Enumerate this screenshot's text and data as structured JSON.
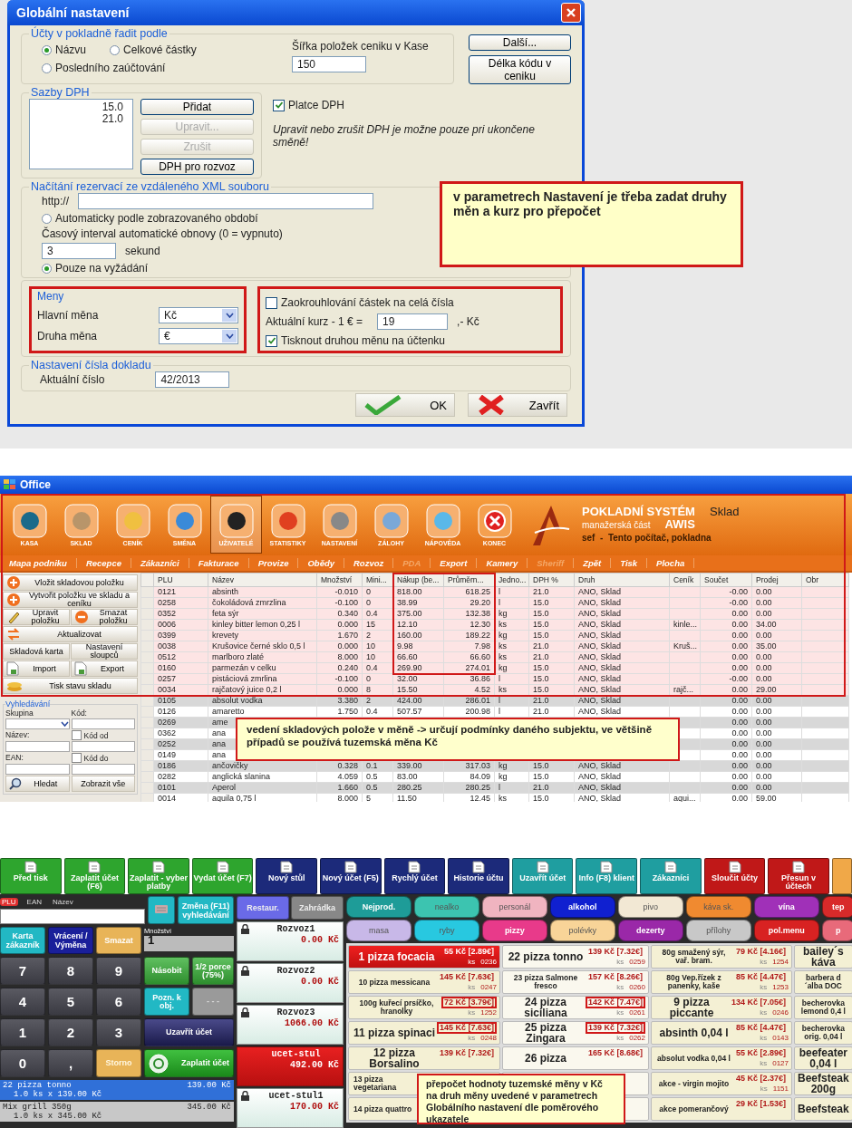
{
  "dialog": {
    "title": "Globální nastavení",
    "sort": {
      "legend": "Účty v pokladně řadit podle",
      "options": [
        {
          "label": "Názvu",
          "selected": true
        },
        {
          "label": "Celkové částky",
          "selected": false
        },
        {
          "label": "Posledního zaúčtování",
          "selected": false
        }
      ],
      "width_label": "Šířka položek ceniku v Kase",
      "width_value": "150"
    },
    "side_buttons": [
      "Další...",
      "Délka kódu v ceniku"
    ],
    "vat": {
      "legend": "Sazby DPH",
      "rates": [
        "15.0",
        "21.0"
      ],
      "buttons": [
        {
          "label": "Přidat",
          "disabled": false
        },
        {
          "label": "Upravit...",
          "disabled": true
        },
        {
          "label": "Zrušit",
          "disabled": true
        },
        {
          "label": "DPH pro rozvoz",
          "disabled": false
        }
      ]
    },
    "vat_payer": {
      "label": "Platce DPH",
      "checked": true
    },
    "note": "Upravit nebo zrušit DPH je možne pouze pri ukončene směně!",
    "reservations": {
      "legend": "Načítání rezervací ze vzdáleného XML souboru",
      "url_label": "http://",
      "auto": {
        "label": "Automaticky podle zobrazovaného období",
        "selected": false
      },
      "interval_label": "Časový interval automatické obnovy (0 = vypnuto)",
      "interval_value": "3",
      "interval_unit": "sekund",
      "on_demand": {
        "label": "Pouze na vyžádání",
        "selected": true
      }
    },
    "currencies": {
      "legend": "Meny",
      "fields": [
        {
          "label": "Hlavní měna",
          "value": "Kč"
        },
        {
          "label": "Druha měna",
          "value": "€"
        }
      ],
      "rounding": {
        "label": "Zaokrouhlování částek na celá čísla",
        "checked": false
      },
      "rate_label": "Aktuální kurz - 1 € =",
      "rate_value": "19",
      "rate_unit": ",- Kč",
      "print_second": {
        "label": "Tisknout druhou měnu na účtenku",
        "checked": true
      }
    },
    "document": {
      "legend": "Nastavení čísla dokladu",
      "label": "Aktuální číslo",
      "value": "42/2013"
    },
    "buttons": [
      {
        "kind": "ok",
        "label": "OK"
      },
      {
        "kind": "close",
        "label": "Zavřít"
      }
    ],
    "callout": "v parametrech Nastavení je třeba zadat druhy měn a kurz pro přepočet"
  },
  "office": {
    "title": "Office",
    "toolbar": [
      {
        "label": "KASA",
        "selected": false
      },
      {
        "label": "SKLAD",
        "selected": false
      },
      {
        "label": "CENÍK",
        "selected": false
      },
      {
        "label": "SMĚNA",
        "selected": false
      },
      {
        "label": "UŽIVATELÉ",
        "selected": true
      },
      {
        "label": "STATISTIKY",
        "selected": false
      },
      {
        "label": "NASTAVENÍ",
        "selected": false
      },
      {
        "label": "ZÁLOHY",
        "selected": false
      },
      {
        "label": "NÁPOVĚDA",
        "selected": false
      },
      {
        "label": "KONEC",
        "selected": false
      }
    ],
    "brand": {
      "title": "POKLADNÍ SYSTÉM",
      "subtitle": "manažerská část",
      "name": "AWIS",
      "module": "Sklad",
      "user": "sef  -  Tento počítač, pokladna"
    },
    "menu": [
      {
        "label": "Mapa podniku",
        "disabled": false
      },
      {
        "label": "Recepce",
        "disabled": false
      },
      {
        "label": "Zákazníci",
        "disabled": false
      },
      {
        "label": "Fakturace",
        "disabled": false
      },
      {
        "label": "Provize",
        "disabled": false
      },
      {
        "label": "Obědy",
        "disabled": false
      },
      {
        "label": "Rozvoz",
        "disabled": false
      },
      {
        "label": "PDA",
        "disabled": true
      },
      {
        "label": "Export",
        "disabled": false
      },
      {
        "label": "Kamery",
        "disabled": false
      },
      {
        "label": "Sheriff",
        "disabled": true
      },
      {
        "label": "Zpět",
        "disabled": false
      },
      {
        "label": "Tisk",
        "disabled": false
      },
      {
        "label": "Plocha",
        "disabled": false
      }
    ],
    "actions": [
      {
        "label": "Vložit skladovou položku",
        "kind": "wide"
      },
      {
        "label": "Vytvořit položku ve skladu a ceníku",
        "kind": "wide"
      },
      {
        "label": "Upravit položku",
        "kind": "half"
      },
      {
        "label": "Smazat položku",
        "kind": "half"
      },
      {
        "label": "Aktualizovat",
        "kind": "wide"
      },
      {
        "label": "Skladová karta",
        "kind": "half"
      },
      {
        "label": "Nastavení sloupců",
        "kind": "half"
      },
      {
        "label": "Import",
        "kind": "half"
      },
      {
        "label": "Export",
        "kind": "half"
      },
      {
        "label": "Tisk stavu skladu",
        "kind": "wide"
      }
    ],
    "search": {
      "legend": "Vyhledávání",
      "group_label": "Skupina",
      "code_label": "Kód:",
      "name_label": "Název:",
      "code_from": {
        "label": "Kód od",
        "checked": false
      },
      "ean_label": "EAN:",
      "code_to": {
        "label": "Kód do",
        "checked": false
      },
      "buttons": [
        "Hledat",
        "Zobrazit vše"
      ]
    },
    "table": {
      "columns": [
        "PLU",
        "Název",
        "Množství",
        "Mini...",
        "Nákup (be...",
        "Průměrn...",
        "Jedno...",
        "DPH %",
        "Druh",
        "Ceník",
        "Součet",
        "Prodej",
        "Obr"
      ],
      "rows": [
        {
          "highlighted": true,
          "cells": [
            "0121",
            "absinth",
            "-0.010",
            "0",
            "818.00",
            "618.25",
            "l",
            "21.0",
            "ANO, Sklad",
            null,
            "-0.00",
            "0.00"
          ]
        },
        {
          "highlighted": true,
          "cells": [
            "0258",
            "čokoládová zmrzlina",
            "-0.100",
            "0",
            "38.99",
            "29.20",
            "l",
            "15.0",
            "ANO, Sklad",
            null,
            "-0.00",
            "0.00"
          ]
        },
        {
          "highlighted": true,
          "cells": [
            "0352",
            "feta sýr",
            "0.340",
            "0.4",
            "375.00",
            "132.38",
            "kg",
            "15.0",
            "ANO, Sklad",
            null,
            "0.00",
            "0.00"
          ]
        },
        {
          "highlighted": true,
          "cells": [
            "0006",
            "kinley bitter lemon 0,25 l",
            "0.000",
            "15",
            "12.10",
            "12.30",
            "ks",
            "15.0",
            "ANO, Sklad",
            "kinle...",
            "0.00",
            "34.00"
          ]
        },
        {
          "highlighted": true,
          "cells": [
            "0399",
            "krevety",
            "1.670",
            "2",
            "160.00",
            "189.22",
            "kg",
            "15.0",
            "ANO, Sklad",
            null,
            "0.00",
            "0.00"
          ]
        },
        {
          "highlighted": true,
          "cells": [
            "0038",
            "Krušovice černé sklo 0,5 l",
            "0.000",
            "10",
            "9.98",
            "7.98",
            "ks",
            "21.0",
            "ANO, Sklad",
            "Kruš...",
            "0.00",
            "35.00"
          ]
        },
        {
          "highlighted": true,
          "cells": [
            "0512",
            "marlboro zlaté",
            "8.000",
            "10",
            "66.60",
            "66.60",
            "ks",
            "21.0",
            "ANO, Sklad",
            null,
            "0.00",
            "0.00"
          ]
        },
        {
          "highlighted": true,
          "cells": [
            "0160",
            "parmezán v celku",
            "0.240",
            "0.4",
            "269.90",
            "274.01",
            "kg",
            "15.0",
            "ANO, Sklad",
            null,
            "0.00",
            "0.00"
          ]
        },
        {
          "highlighted": true,
          "cells": [
            "0257",
            "pistáciová zmrlina",
            "-0.100",
            "0",
            "32.00",
            "36.86",
            "l",
            "15.0",
            "ANO, Sklad",
            null,
            "-0.00",
            "0.00"
          ]
        },
        {
          "highlighted": true,
          "cells": [
            "0034",
            "rajčatový juice 0,2 l",
            "0.000",
            "8",
            "15.50",
            "4.52",
            "ks",
            "15.0",
            "ANO, Sklad",
            "rajč...",
            "0.00",
            "29.00"
          ]
        },
        {
          "highlighted": false,
          "cells": [
            "0105",
            "absolut vodka",
            "3.380",
            "2",
            "424.00",
            "286.01",
            "l",
            "21.0",
            "ANO, Sklad",
            null,
            "0.00",
            "0.00"
          ]
        },
        {
          "highlighted": false,
          "cells": [
            "0126",
            "amaretto",
            "1.750",
            "0.4",
            "507.57",
            "200.98",
            "l",
            "21.0",
            "ANO, Sklad",
            null,
            "0.00",
            "0.00"
          ]
        },
        {
          "highlighted": false,
          "cells": [
            "0269",
            "ame",
            null,
            null,
            null,
            null,
            null,
            null,
            null,
            null,
            "0.00",
            "0.00"
          ]
        },
        {
          "highlighted": false,
          "cells": [
            "0362",
            "ana",
            null,
            null,
            null,
            null,
            null,
            null,
            null,
            null,
            "0.00",
            "0.00"
          ]
        },
        {
          "highlighted": false,
          "cells": [
            "0252",
            "ana",
            null,
            null,
            null,
            null,
            null,
            null,
            null,
            null,
            "0.00",
            "0.00"
          ]
        },
        {
          "highlighted": false,
          "cells": [
            "0149",
            "ana",
            null,
            null,
            null,
            null,
            null,
            null,
            null,
            null,
            "0.00",
            "0.00"
          ]
        },
        {
          "highlighted": false,
          "cells": [
            "0186",
            "ančovičky",
            "0.328",
            "0.1",
            "339.00",
            "317.03",
            "kg",
            "15.0",
            "ANO, Sklad",
            null,
            "0.00",
            "0.00"
          ]
        },
        {
          "highlighted": false,
          "cells": [
            "0282",
            "anglická slanina",
            "4.059",
            "0.5",
            "83.00",
            "84.09",
            "kg",
            "15.0",
            "ANO, Sklad",
            null,
            "0.00",
            "0.00"
          ]
        },
        {
          "highlighted": false,
          "cells": [
            "0101",
            "Aperol",
            "1.660",
            "0.5",
            "280.25",
            "280.25",
            "l",
            "21.0",
            "ANO, Sklad",
            null,
            "0.00",
            "0.00"
          ]
        },
        {
          "highlighted": false,
          "cells": [
            "0014",
            "aquila 0,75 l",
            "8.000",
            "5",
            "11.50",
            "12.45",
            "ks",
            "15.0",
            "ANO, Sklad",
            "aqui...",
            "0.00",
            "59.00"
          ]
        }
      ]
    },
    "callout": "vedení skladových polože v měně -> určují podmínky daného subjektu, ve většině případů se používá tuzemská měna Kč"
  },
  "pos": {
    "top_buttons": [
      {
        "label": "Před tisk",
        "color": "#2ea52e"
      },
      {
        "label": "Zaplatit účet (F6)",
        "color": "#2ea52e"
      },
      {
        "label": "Zaplatit - vyber platby",
        "color": "#2ea52e"
      },
      {
        "label": "Vydat účet (F7)",
        "color": "#2ea52e"
      },
      {
        "label": "Nový stůl",
        "color": "#1c2a7a"
      },
      {
        "label": "Nový účet (F5)",
        "color": "#1c2a7a"
      },
      {
        "label": "Rychlý účet",
        "color": "#1c2a7a"
      },
      {
        "label": "Historie účtu",
        "color": "#1c2a7a"
      },
      {
        "label": "Uzavřít účet",
        "color": "#1f9ea0"
      },
      {
        "label": "Info (F8) klient",
        "color": "#1f9ea0"
      },
      {
        "label": "Zákazníci",
        "color": "#1f9ea0"
      },
      {
        "label": "Sloučit účty",
        "color": "#c01818"
      },
      {
        "label": "Přesun v účtech",
        "color": "#c01818"
      },
      {
        "color": "#f0a848"
      }
    ],
    "search": {
      "modes": [
        {
          "label": "PLU",
          "selected": true
        },
        {
          "label": "EAN",
          "selected": false
        },
        {
          "label": "Název",
          "selected": false
        }
      ],
      "toggle": "Změna (F11) vyhledávání"
    },
    "function_keys": [
      {
        "label": "Karta zákazník",
        "color": "#22b8c4"
      },
      {
        "label": "Vrácení / Výměna",
        "color": "#1a1f9a"
      },
      {
        "label": "Smazat",
        "color": "#e8b458"
      }
    ],
    "quantity": {
      "label": "Množství",
      "value": "1"
    },
    "keypad": [
      {
        "label": "7",
        "kind": "digit"
      },
      {
        "label": "8",
        "kind": "digit"
      },
      {
        "label": "9",
        "kind": "digit"
      },
      {
        "label": "Násobit",
        "kind": "green"
      },
      {
        "label": "1/2 porce (75%)",
        "kind": "green"
      },
      {
        "label": "4",
        "kind": "digit"
      },
      {
        "label": "5",
        "kind": "digit"
      },
      {
        "label": "6",
        "kind": "digit"
      },
      {
        "label": "Pozn. k obj.",
        "kind": "teal"
      },
      {
        "label": "- - -",
        "kind": "grey"
      },
      {
        "label": "1",
        "kind": "digit"
      },
      {
        "label": "2",
        "kind": "digit"
      },
      {
        "label": "3",
        "kind": "digit"
      },
      {
        "label": "Uzavřít účet",
        "kind": "close"
      },
      {
        "label": "0",
        "kind": "digit"
      },
      {
        "label": ",",
        "kind": "digit"
      },
      {
        "label": "Storno",
        "kind": "storno"
      },
      {
        "label": "Zaplatit účet",
        "kind": "pay"
      }
    ],
    "order": [
      {
        "name": "22 pizza tonno",
        "price": "139.00 Kč",
        "detail": "1.0 ks x 139.00 Kč",
        "selected": true
      },
      {
        "name": "Mix grill 350g",
        "price": "345.00 Kč",
        "detail": "1.0 ks x 345.00 Kč",
        "selected": false
      }
    ],
    "areas": [
      {
        "label": "Restaur.",
        "selected": true
      },
      {
        "label": "Zahrádka",
        "selected": false
      }
    ],
    "tables": [
      {
        "name": "Rozvoz1",
        "total": "0.00 Kč",
        "locked": true,
        "selected": false
      },
      {
        "name": "Rozvoz2",
        "total": "0.00 Kč",
        "locked": true,
        "selected": false
      },
      {
        "name": "Rozvoz3",
        "total": "1066.00 Kč",
        "locked": true,
        "selected": false
      },
      {
        "name": "ucet-stul",
        "total": "492.00 Kč",
        "locked": false,
        "selected": true
      },
      {
        "name": "ucet-stul1",
        "total": "170.00 Kč",
        "locked": true,
        "selected": false
      }
    ],
    "categories": [
      [
        {
          "label": "Nejprod.",
          "color": "#1e9c98",
          "dimmed": false
        },
        {
          "label": "nealko",
          "color": "#3cc4b0",
          "dimmed": true
        },
        {
          "label": "personál",
          "color": "#f0b4c0",
          "dimmed": true
        },
        {
          "label": "alkohol",
          "color": "#1020d0",
          "dimmed": false
        },
        {
          "label": "pivo",
          "color": "#f2e8d4",
          "dimmed": true
        },
        {
          "label": "káva sk.",
          "color": "#f08a30",
          "dimmed": true
        },
        {
          "label": "vína",
          "color": "#a030b8",
          "dimmed": false
        },
        {
          "label": "tep",
          "color": "#d82a2a",
          "dimmed": false
        }
      ],
      [
        {
          "label": "masa",
          "color": "#c8b8e8",
          "dimmed": true
        },
        {
          "label": "ryby",
          "color": "#28c8e0",
          "dimmed": true
        },
        {
          "label": "pizzy",
          "color": "#e83a8a",
          "dimmed": false
        },
        {
          "label": "polévky",
          "color": "#f8d498",
          "dimmed": true
        },
        {
          "label": "dezerty",
          "color": "#9a28a8",
          "dimmed": false
        },
        {
          "label": "přílohy",
          "color": "#c8c8c8",
          "dimmed": true
        },
        {
          "label": "pol.menu",
          "color": "#d82222",
          "dimmed": false
        },
        {
          "label": "p",
          "color": "#e86a7a",
          "dimmed": false
        }
      ]
    ],
    "products": [
      {
        "name": "1 pizza focacia",
        "price": "55 Kč [2.89€]",
        "unit": "ks",
        "code": "0236",
        "kind": "large",
        "selected": true,
        "highlighted": false
      },
      {
        "name": "22 pizza tonno",
        "price": "139 Kč [7.32€]",
        "unit": "ks",
        "code": "0259",
        "kind": "large",
        "selected": false,
        "highlighted": false
      },
      {
        "name": "80g smažený sýr, vař. bram.",
        "price": "79 Kč [4.16€]",
        "unit": "ks",
        "code": "1254",
        "kind": "small",
        "selected": false,
        "highlighted": false
      },
      {
        "name": "bailey´s káva",
        "kind": "large",
        "selected": false
      },
      {
        "name": "10 pizza messicana",
        "price": "145 Kč [7.63€]",
        "unit": "ks",
        "code": "0247",
        "kind": "small",
        "selected": false,
        "highlighted": false
      },
      {
        "name": "23 pizza Salmone fresco",
        "price": "157 Kč [8.26€]",
        "unit": "ks",
        "code": "0260",
        "kind": "small",
        "selected": false,
        "highlighted": false
      },
      {
        "name": "80g Vep.řízek z panenky, kaše",
        "price": "85 Kč [4.47€]",
        "unit": "ks",
        "code": "1253",
        "kind": "small",
        "selected": false,
        "highlighted": false
      },
      {
        "name": "barbera d´alba DOC",
        "kind": "small",
        "selected": false
      },
      {
        "name": "100g kuřecí prsíčko, hranolky",
        "price": "72 Kč [3.79€]",
        "unit": "ks",
        "code": "1252",
        "kind": "small",
        "selected": false,
        "highlighted": true
      },
      {
        "name": "24 pizza siciliana",
        "price": "142 Kč [7.47€]",
        "unit": "ks",
        "code": "0261",
        "kind": "large",
        "selected": false,
        "highlighted": true
      },
      {
        "name": "9 pizza piccante",
        "price": "134 Kč [7.05€]",
        "unit": "ks",
        "code": "0246",
        "kind": "large",
        "selected": false,
        "highlighted": false
      },
      {
        "name": "becherovka lemond 0,4 l",
        "kind": "small",
        "selected": false
      },
      {
        "name": "11 pizza spinaci",
        "price": "145 Kč [7.63€]",
        "unit": "ks",
        "code": "0248",
        "kind": "large",
        "selected": false,
        "highlighted": true
      },
      {
        "name": "25 pizza Zingara",
        "price": "139 Kč [7.32€]",
        "unit": "ks",
        "code": "0262",
        "kind": "large",
        "selected": false,
        "highlighted": true
      },
      {
        "name": "absinth 0,04 l",
        "price": "85 Kč [4.47€]",
        "unit": "ks",
        "code": "0143",
        "kind": "large",
        "selected": false,
        "highlighted": false
      },
      {
        "name": "becherovka orig. 0,04 l",
        "kind": "small",
        "selected": false
      },
      {
        "name": "12 pizza Borsalino",
        "price": "139 Kč [7.32€]",
        "kind": "large",
        "selected": false,
        "highlighted": false
      },
      {
        "name": "26 pizza",
        "price": "165 Kč [8.68€]",
        "kind": "large",
        "selected": false,
        "highlighted": false
      },
      {
        "name": "absolut vodka 0,04 l",
        "price": "55 Kč [2.89€]",
        "unit": "ks",
        "code": "0127",
        "kind": "small",
        "selected": false,
        "highlighted": false
      },
      {
        "name": "beefeater 0,04 l",
        "kind": "large",
        "selected": false
      },
      {
        "name": "13 pizza vegetariana",
        "kind": "small",
        "selected": false
      },
      {
        "kind": "covered"
      },
      {
        "name": "akce - virgin mojito",
        "price": "45 Kč [2.37€]",
        "unit": "ks",
        "code": "1151",
        "kind": "small",
        "selected": false,
        "highlighted": false
      },
      {
        "name": "Beefsteak 200g",
        "kind": "large",
        "selected": false
      },
      {
        "name": "14 pizza quattro",
        "kind": "small",
        "selected": false
      },
      {
        "kind": "covered"
      },
      {
        "name": "akce pomerančový",
        "price": "29 Kč [1.53€]",
        "kind": "small",
        "selected": false,
        "highlighted": false
      },
      {
        "name": "Beefsteak",
        "kind": "large",
        "selected": false
      }
    ],
    "callout": "přepočet hodnoty tuzemské měny v Kč na druh měny uvedené v parametrech Globálního nastavení dle poměrového ukazatele"
  }
}
